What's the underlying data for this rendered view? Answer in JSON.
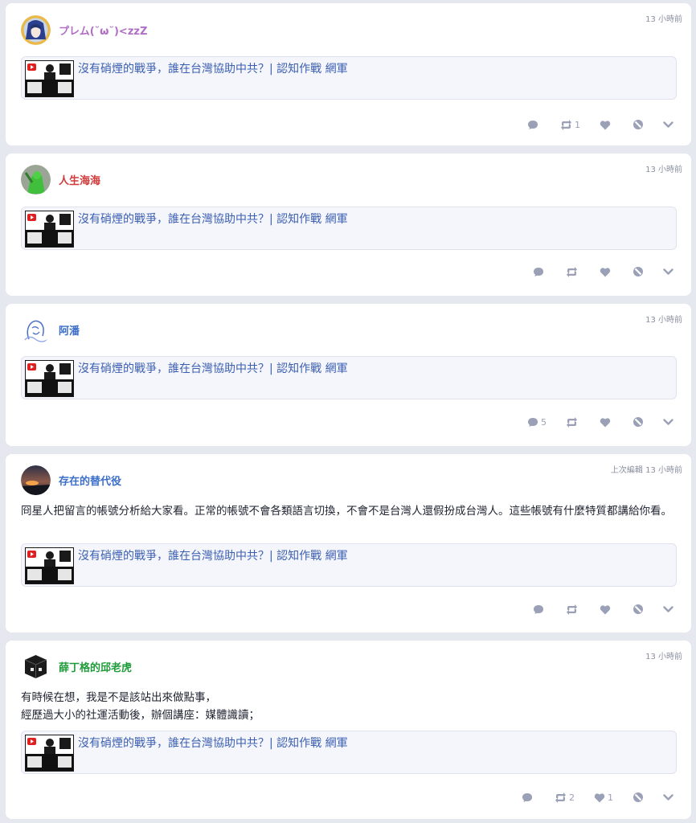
{
  "colors": {
    "bg": "#e6e8f0",
    "card": "#ffffff",
    "link": "#3b5fb0",
    "icon": "#9aa0b6"
  },
  "posts": [
    {
      "author": "プレム(˘ω˘)<zzZ",
      "author_color": "#b06fc4",
      "time": "13 小時前",
      "text": "",
      "link_title": "沒有硝煙的戰爭，誰在台灣協助中共？| 認知作戰 網軍",
      "counts": {
        "reply": "",
        "boost": "1",
        "fav": ""
      }
    },
    {
      "author": "人生海海",
      "author_color": "#d13a3a",
      "time": "13 小時前",
      "text": "",
      "link_title": "沒有硝煙的戰爭，誰在台灣協助中共？| 認知作戰 網軍",
      "counts": {
        "reply": "",
        "boost": "",
        "fav": ""
      }
    },
    {
      "author": "阿潘",
      "author_color": "#3b6ec9",
      "time": "13 小時前",
      "text": "",
      "link_title": "沒有硝煙的戰爭，誰在台灣協助中共？| 認知作戰 網軍",
      "counts": {
        "reply": "5",
        "boost": "",
        "fav": ""
      }
    },
    {
      "author": "存在的替代役",
      "author_color": "#3b6ec9",
      "time": "上次編輯 13 小時前",
      "text": "冏星人把留言的帳號分析給大家看。正常的帳號不會各類語言切換，不會不是台灣人還假扮成台灣人。這些帳號有什麼特質都講給你看。",
      "link_title": "沒有硝煙的戰爭，誰在台灣協助中共？| 認知作戰 網軍",
      "counts": {
        "reply": "",
        "boost": "",
        "fav": ""
      }
    },
    {
      "author": "薛丁格的邱老虎",
      "author_color": "#1e9c3a",
      "time": "13 小時前",
      "text": "有時候在想，我是不是該站出來做點事，\n經歷過大小的社運活動後，辦個講座：媒體識讀；",
      "link_title": "沒有硝煙的戰爭，誰在台灣協助中共？| 認知作戰 網軍",
      "counts": {
        "reply": "",
        "boost": "2",
        "fav": "1"
      }
    }
  ]
}
